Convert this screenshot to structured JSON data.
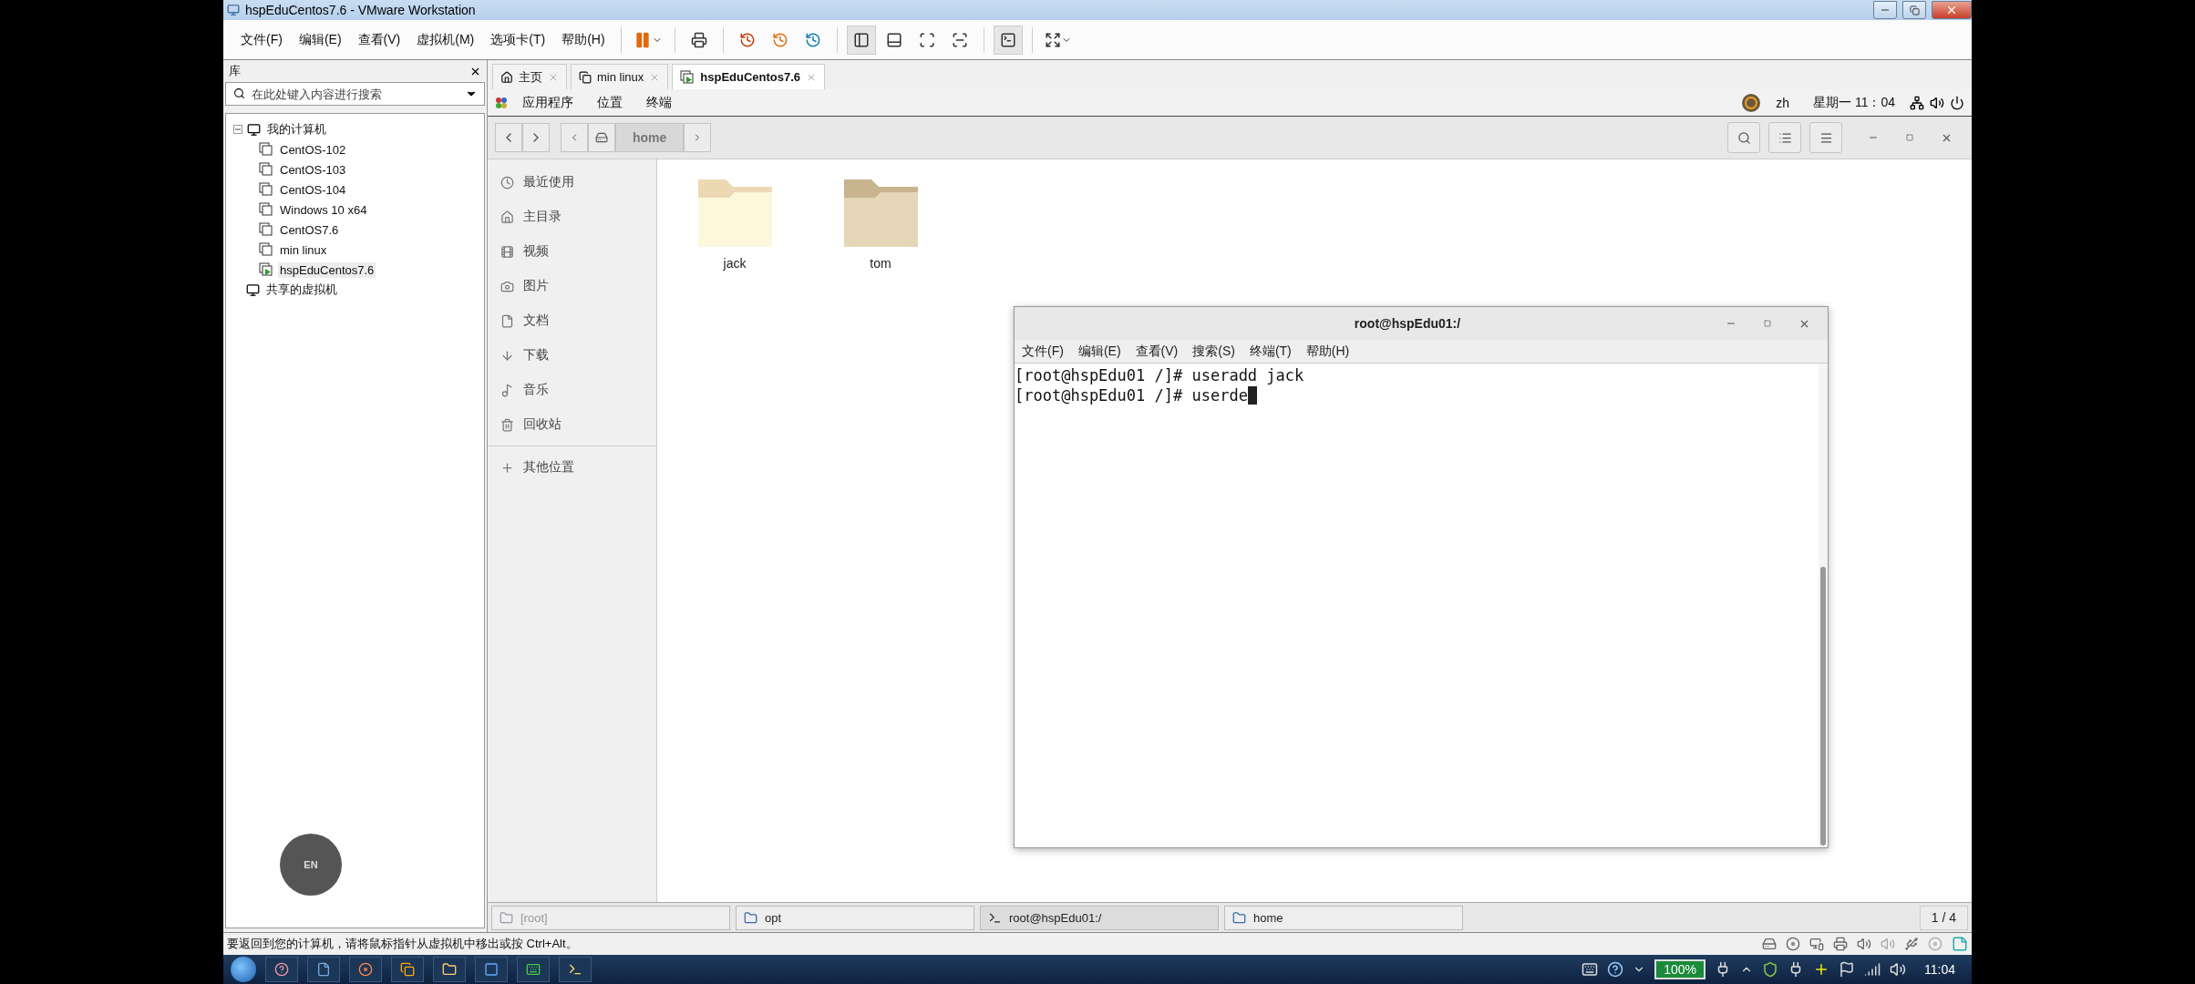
{
  "window": {
    "title": "hspEduCentos7.6 - VMware Workstation"
  },
  "menu": [
    "文件(F)",
    "编辑(E)",
    "查看(V)",
    "虚拟机(M)",
    "选项卡(T)",
    "帮助(H)"
  ],
  "library": {
    "title": "库",
    "search": {
      "placeholder": "在此处键入内容进行搜索"
    },
    "tree": [
      {
        "label": "我的计算机",
        "expanded": true,
        "children": [
          {
            "label": "CentOS-102",
            "selected": false,
            "running": false
          },
          {
            "label": "CentOS-103",
            "selected": false,
            "running": false
          },
          {
            "label": "CentOS-104",
            "selected": false,
            "running": false
          },
          {
            "label": "Windows 10 x64",
            "selected": false,
            "running": false
          },
          {
            "label": "CentOS7.6",
            "selected": false,
            "running": false
          },
          {
            "label": "min linux",
            "selected": false,
            "running": false
          },
          {
            "label": "hspEduCentos7.6",
            "selected": true,
            "running": true
          }
        ]
      },
      {
        "label": "共享的虚拟机"
      }
    ],
    "ime_badge": "EN"
  },
  "tabs": [
    {
      "label": "主页",
      "selected": false,
      "kind": "home"
    },
    {
      "label": "min linux",
      "selected": false,
      "kind": "vm"
    },
    {
      "label": "hspEduCentos7.6",
      "selected": true,
      "kind": "vm-running"
    }
  ],
  "guest": {
    "top_bar": {
      "menus": [
        "应用程序",
        "位置",
        "终端"
      ],
      "lang": "zh",
      "clock": "星期一 11：04"
    },
    "files": {
      "path": "home",
      "places": [
        {
          "label": "最近使用",
          "kind": "recent"
        },
        {
          "label": "主目录",
          "kind": "home"
        },
        {
          "label": "视频",
          "kind": "video"
        },
        {
          "label": "图片",
          "kind": "pictures"
        },
        {
          "label": "文档",
          "kind": "documents"
        },
        {
          "label": "下载",
          "kind": "downloads"
        },
        {
          "label": "音乐",
          "kind": "music"
        },
        {
          "label": "回收站",
          "kind": "trash"
        }
      ],
      "other_places": "其他位置",
      "items": [
        {
          "name": "jack",
          "highlighted": true
        },
        {
          "name": "tom",
          "highlighted": false
        }
      ]
    },
    "terminal": {
      "title": "root@hspEdu01:/",
      "menu": [
        "文件(F)",
        "编辑(E)",
        "查看(V)",
        "搜索(S)",
        "终端(T)",
        "帮助(H)"
      ],
      "lines": [
        "[root@hspEdu01 /]# useradd jack",
        "[root@hspEdu01 /]# userde"
      ]
    },
    "window_list": [
      {
        "label": "[root]",
        "kind": "files",
        "selected": false,
        "minimized": true
      },
      {
        "label": "opt",
        "kind": "files",
        "selected": false,
        "minimized": false
      },
      {
        "label": "root@hspEdu01:/",
        "kind": "terminal",
        "selected": true,
        "minimized": false
      },
      {
        "label": "home",
        "kind": "files",
        "selected": false,
        "minimized": false
      }
    ],
    "workspace": "1 / 4"
  },
  "status_bar": "要返回到您的计算机，请将鼠标指针从虚拟机中移出或按 Ctrl+Alt。",
  "taskbar": {
    "battery": "100%",
    "clock": "11:04"
  }
}
